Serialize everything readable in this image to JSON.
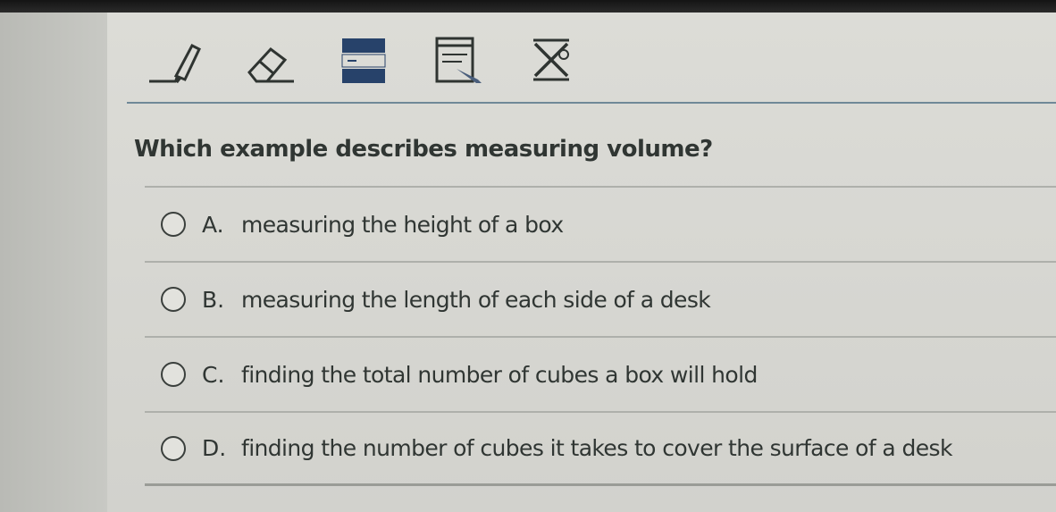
{
  "toolbar": {
    "tools": [
      {
        "name": "highlighter-icon"
      },
      {
        "name": "eraser-icon"
      },
      {
        "name": "line-reader-icon"
      },
      {
        "name": "notepad-icon"
      },
      {
        "name": "answer-eliminator-icon"
      }
    ]
  },
  "question": {
    "text": "Which example describes measuring volume?"
  },
  "options": [
    {
      "letter": "A.",
      "text": "measuring the height of a box"
    },
    {
      "letter": "B.",
      "text": "measuring the length of each side of a desk"
    },
    {
      "letter": "C.",
      "text": "finding the total number of cubes a box will hold"
    },
    {
      "letter": "D.",
      "text": "finding the number of cubes it takes to cover the surface of a desk"
    }
  ],
  "colors": {
    "panel": "#d9d9d4",
    "text": "#303633",
    "divider": "#6f8898"
  }
}
